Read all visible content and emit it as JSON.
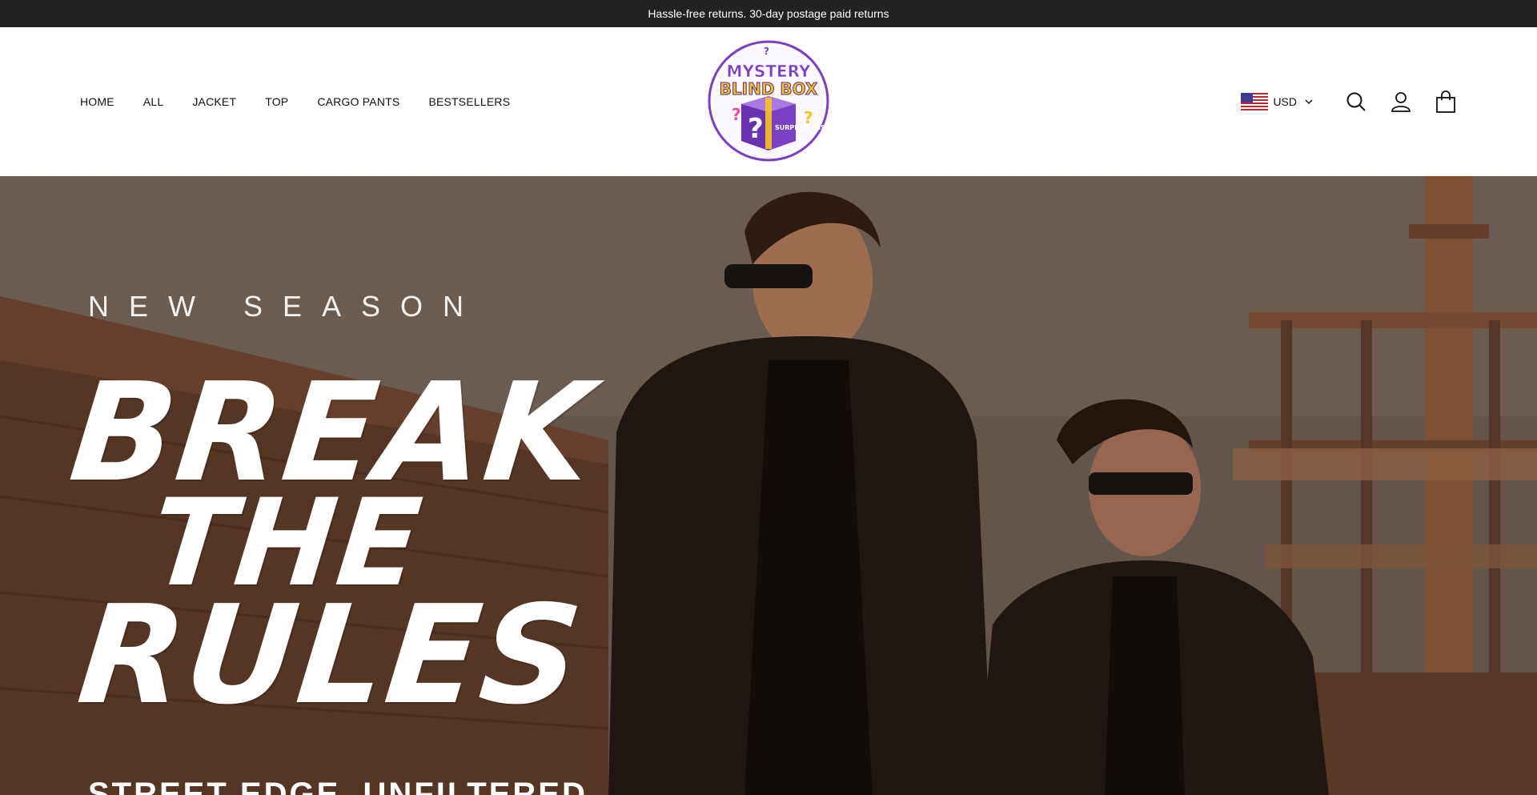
{
  "announcement": {
    "text": "Hassle-free returns. 30-day postage paid returns"
  },
  "nav": {
    "items": [
      {
        "label": "HOME"
      },
      {
        "label": "ALL"
      },
      {
        "label": "JACKET"
      },
      {
        "label": "TOP"
      },
      {
        "label": "CARGO PANTS"
      },
      {
        "label": "BESTSELLERS"
      }
    ]
  },
  "logo": {
    "line1": "MYSTERY",
    "line2": "BLIND BOX",
    "box_text": "SURPRISE INSIDE!"
  },
  "header_actions": {
    "currency": "USD",
    "icons": [
      "us-flag-icon",
      "chevron-down-icon",
      "search-icon",
      "account-icon",
      "cart-icon"
    ]
  },
  "hero": {
    "eyebrow": "NEW SEASON",
    "headline": [
      "BREAK",
      "THE",
      "RULES"
    ],
    "subhead": "STREET EDGE. UNFILTERED"
  },
  "colors": {
    "announcement_bg": "#222222",
    "logo_purple": "#7b3fc4",
    "logo_yellow": "#f5c518",
    "text": "#111111"
  }
}
